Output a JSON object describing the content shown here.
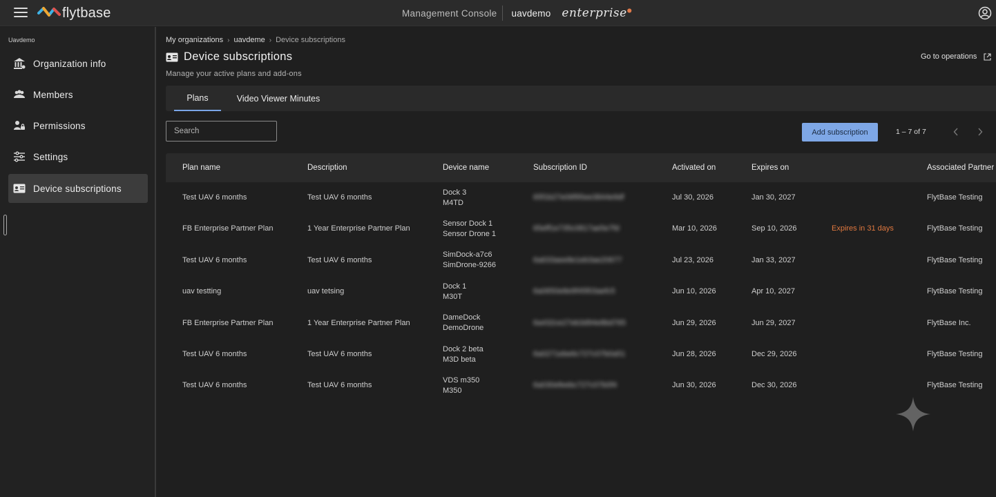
{
  "header": {
    "brand": "flytbase",
    "console_label": "Management Console",
    "org_name": "uavdemo",
    "edition": "enterprise"
  },
  "sidebar": {
    "org_label": "Uavdemo",
    "items": [
      {
        "label": "Organization info",
        "icon": "bank-icon"
      },
      {
        "label": "Members",
        "icon": "members-icon"
      },
      {
        "label": "Permissions",
        "icon": "permissions-icon"
      },
      {
        "label": "Settings",
        "icon": "settings-icon"
      },
      {
        "label": "Device subscriptions",
        "icon": "subscription-card-icon",
        "active": true
      }
    ]
  },
  "breadcrumb": [
    "My organizations",
    "uavdeme",
    "Device subscriptions"
  ],
  "page": {
    "title": "Device subscriptions",
    "subtitle": "Manage your active plans and add-ons",
    "go_to_operations": "Go to operations"
  },
  "tabs": [
    {
      "label": "Plans",
      "active": true
    },
    {
      "label": "Video Viewer Minutes",
      "active": false
    }
  ],
  "toolbar": {
    "search_placeholder": "Search",
    "add_label": "Add subscription",
    "paging": "1 – 7 of 7"
  },
  "table": {
    "columns": [
      "Plan name",
      "Description",
      "Device name",
      "Subscription ID",
      "Activated on",
      "Expires on",
      "",
      "Associated Partner"
    ],
    "rows": [
      {
        "plan": "Test UAV 6 months",
        "desc": "Test UAV 6 months",
        "dev1": "Dock 3",
        "dev2": "M4TD",
        "sid": "65f1b27e06f95ee3844e9df",
        "act": "Jul 30, 2026",
        "exp": "Jan 30, 2027",
        "status": "",
        "partner": "FlytBase Testing"
      },
      {
        "plan": "FB Enterprise Partner Plan",
        "desc": "1 Year Enterprise Partner Plan",
        "dev1": "Sensor Dock 1",
        "dev2": "Sensor Drone 1",
        "sid": "65eff1e735c0817ae5e7fd",
        "act": "Mar 10, 2026",
        "exp": "Sep 10, 2026",
        "status": "Expires in 31 days",
        "partner": "FlytBase Testing"
      },
      {
        "plan": "Test UAV 6 months",
        "desc": "Test UAV 6 months",
        "dev1": "SimDock-a7c6",
        "dev2": "SimDrone-9266",
        "sid": "6a633aee8e1eb3ae20677",
        "act": "Jul 23, 2026",
        "exp": "Jan 33, 2027",
        "status": "",
        "partner": "FlytBase Testing"
      },
      {
        "plan": "uav testting",
        "desc": "uav tetsing",
        "dev1": "Dock 1",
        "dev2": "M30T",
        "sid": "6a0650e8e9f45f03aefc5",
        "act": "Jun 10, 2026",
        "exp": "Apr 10, 2027",
        "status": "",
        "partner": "FlytBase Testing"
      },
      {
        "plan": "FB Enterprise Partner Plan",
        "desc": "1 Year Enterprise Partner Plan",
        "dev1": "DameDock",
        "dev2": "DemoDrone",
        "sid": "6a432ce27eb3d94e8bd765",
        "act": "Jun 29, 2026",
        "exp": "Jun 29, 2027",
        "status": "",
        "partner": "FlytBase Inc."
      },
      {
        "plan": "Test UAV 6 months",
        "desc": "Test UAV 6 months",
        "dev1": "Dock 2 beta",
        "dev2": "M3D beta",
        "sid": "6a0271ebe6c727c07b0a51",
        "act": "Jun 28, 2026",
        "exp": "Dec 29, 2026",
        "status": "",
        "partner": "FlytBase Testing"
      },
      {
        "plan": "Test UAV 6 months",
        "desc": "Test UAV 6 months",
        "dev1": "VDS m350",
        "dev2": "M350",
        "sid": "6a030efeebc727c07b0f4",
        "act": "Jun 30, 2026",
        "exp": "Dec 30, 2026",
        "status": "",
        "partner": "FlytBase Testing"
      }
    ]
  },
  "colors": {
    "accent": "#7ea7e6",
    "warning": "#e0783f",
    "background": "#1f1f1f"
  }
}
